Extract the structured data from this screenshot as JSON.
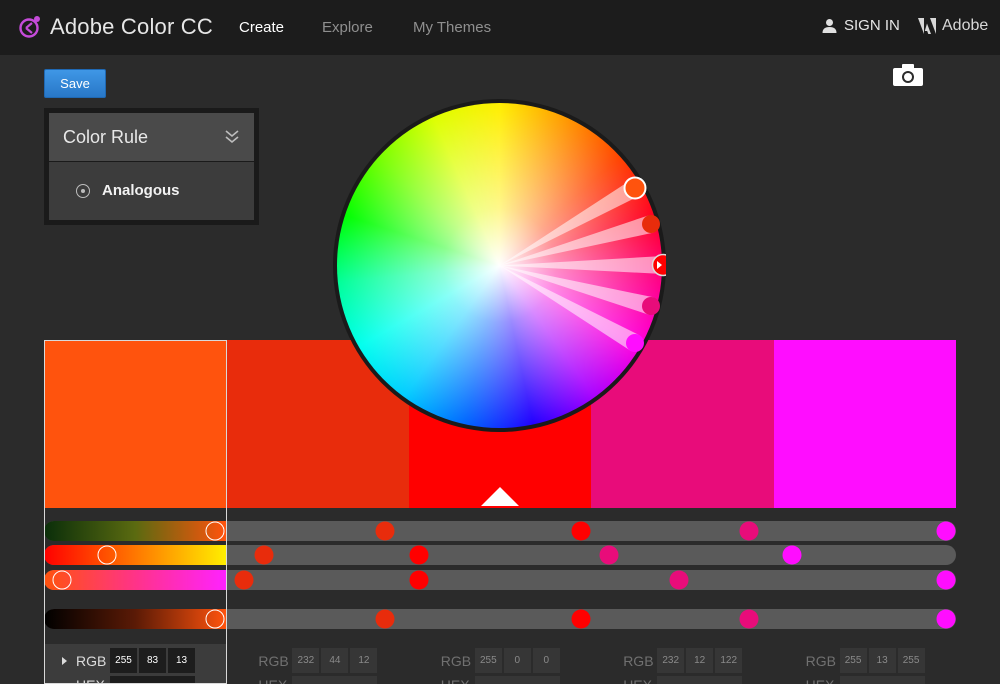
{
  "header": {
    "brand": "Adobe Color CC",
    "nav": [
      {
        "label": "Create",
        "active": true
      },
      {
        "label": "Explore",
        "active": false
      },
      {
        "label": "My Themes",
        "active": false
      }
    ],
    "signin": "SIGN IN",
    "adobe": "Adobe",
    "logo_icon": "adobe-color-logo-icon",
    "user_icon": "user-icon",
    "adobe_icon": "adobe-logo-icon"
  },
  "toolbar": {
    "save_label": "Save",
    "camera_icon": "camera-icon"
  },
  "color_rule": {
    "title": "Color Rule",
    "selected": "Analogous"
  },
  "swatches": [
    {
      "hex": "#FF530D",
      "rgb": [
        "255",
        "83",
        "13"
      ],
      "selected": true
    },
    {
      "hex": "#E82C0C",
      "rgb": [
        "232",
        "44",
        "12"
      ],
      "selected": false
    },
    {
      "hex": "#FF0000",
      "rgb": [
        "255",
        "0",
        "0"
      ],
      "selected": false,
      "base": true
    },
    {
      "hex": "#E80C7A",
      "rgb": [
        "232",
        "12",
        "122"
      ],
      "selected": false
    },
    {
      "hex": "#FF0DFF",
      "rgb": [
        "255",
        "13",
        "255"
      ],
      "selected": false
    }
  ],
  "value_labels": {
    "rgb": "RGB",
    "hex": "HEX"
  }
}
